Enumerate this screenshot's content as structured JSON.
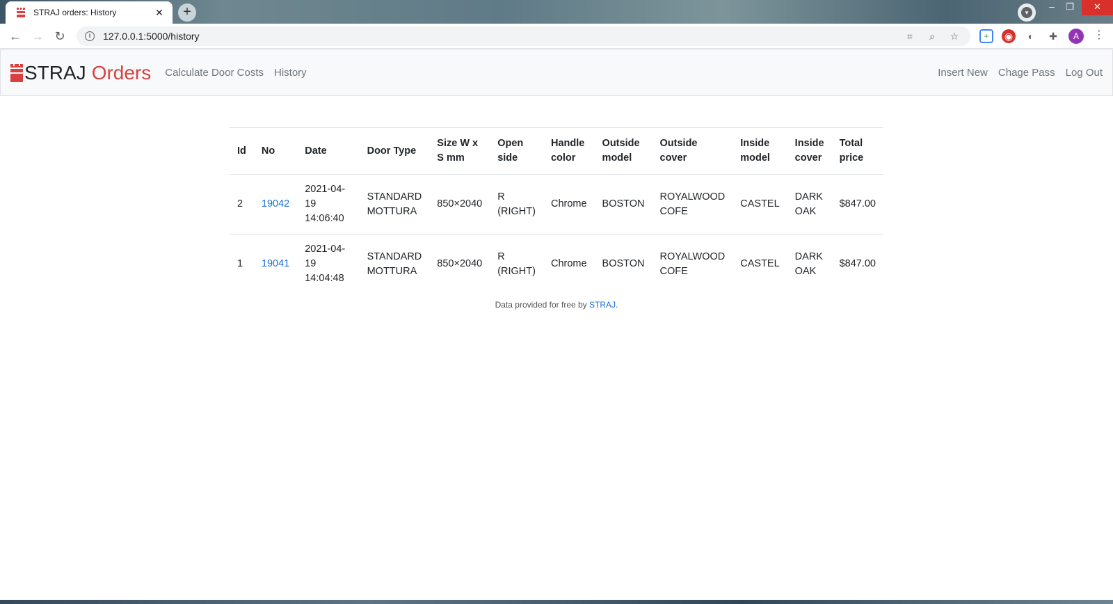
{
  "browser": {
    "tab_title": "STRAJ orders: History",
    "url": "127.0.0.1:5000/history",
    "profile_initial": "A"
  },
  "navbar": {
    "brand_left": "STRAJ",
    "brand_right": "Orders",
    "links": [
      "Calculate Door Costs",
      "History"
    ],
    "right_links": [
      "Insert New",
      "Chage Pass",
      "Log Out"
    ]
  },
  "table": {
    "headers": [
      [
        "Id"
      ],
      [
        "No"
      ],
      [
        "Date"
      ],
      [
        "Door Type"
      ],
      [
        "Size W x",
        "S mm"
      ],
      [
        "Open",
        "side"
      ],
      [
        "Handle",
        "color"
      ],
      [
        "Outside",
        "model"
      ],
      [
        "Outside",
        "cover"
      ],
      [
        "Inside",
        "model"
      ],
      [
        "Inside",
        "cover"
      ],
      [
        "Total",
        "price"
      ]
    ],
    "rows": [
      {
        "id": "2",
        "no": "19042",
        "date": "2021-04-19",
        "time": "14:06:40",
        "door_type_1": "STANDARD",
        "door_type_2": "MOTTURA",
        "size": "850×2040",
        "open_1": "R",
        "open_2": "(RIGHT)",
        "handle": "Chrome",
        "outside_model": "BOSTON",
        "outside_cover_1": "ROYALWOOD",
        "outside_cover_2": "COFE",
        "inside_model": "CASTEL",
        "inside_cover_1": "DARK",
        "inside_cover_2": "OAK",
        "total": "$847.00"
      },
      {
        "id": "1",
        "no": "19041",
        "date": "2021-04-19",
        "time": "14:04:48",
        "door_type_1": "STANDARD",
        "door_type_2": "MOTTURA",
        "size": "850×2040",
        "open_1": "R",
        "open_2": "(RIGHT)",
        "handle": "Chrome",
        "outside_model": "BOSTON",
        "outside_cover_1": "ROYALWOOD",
        "outside_cover_2": "COFE",
        "inside_model": "CASTEL",
        "inside_cover_1": "DARK",
        "inside_cover_2": "OAK",
        "total": "$847.00"
      }
    ]
  },
  "footer": {
    "text": "Data provided for free by ",
    "link": "STRAJ",
    "suffix": "."
  },
  "colors": {
    "brand_red": "#d94040",
    "link_blue": "#1a6fd6"
  }
}
